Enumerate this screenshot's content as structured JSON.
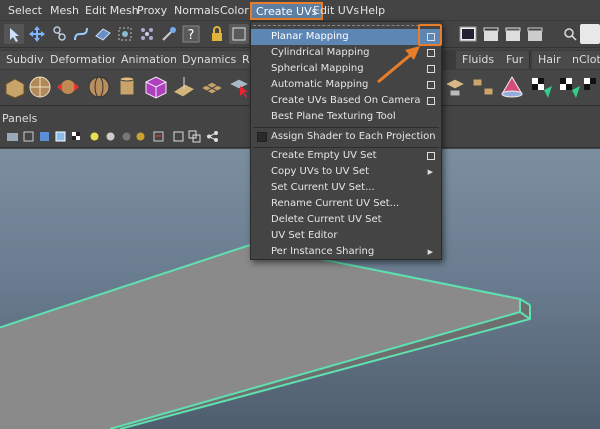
{
  "menubar": {
    "items": [
      "Select",
      "Mesh",
      "Edit Mesh",
      "Proxy",
      "Normals",
      "Color",
      "Create UVs",
      "Edit UVs",
      "Help"
    ]
  },
  "shelf_tabs": [
    "Subdivs",
    "Deformation",
    "Animation",
    "Dynamics",
    "R",
    "Fluids",
    "Fur",
    "Hair",
    "nClot"
  ],
  "panels_label": "Panels",
  "create_uvs_menu": {
    "items": [
      {
        "label": "Planar Mapping",
        "option_box": true,
        "highlight": true
      },
      {
        "label": "Cylindrical Mapping",
        "option_box": true
      },
      {
        "label": "Spherical Mapping",
        "option_box": true
      },
      {
        "label": "Automatic Mapping",
        "option_box": true
      },
      {
        "label": "Create UVs Based On Camera",
        "option_box": true
      },
      {
        "label": "Best Plane Texturing Tool"
      },
      {
        "label": "Assign Shader to Each Projection",
        "checkbox": true
      },
      {
        "label": "Create Empty UV Set",
        "option_box": true
      },
      {
        "label": "Copy UVs to UV Set",
        "submenu": true
      },
      {
        "label": "Set Current UV Set..."
      },
      {
        "label": "Rename Current UV Set..."
      },
      {
        "label": "Delete Current UV Set"
      },
      {
        "label": "UV Set Editor"
      },
      {
        "label": "Per Instance Sharing",
        "submenu": true
      }
    ]
  },
  "colors": {
    "accent": "#e87d2a",
    "highlight": "#5d86b4",
    "wireframe": "#5fe0b0",
    "mesh_top": "#8a8a8a",
    "mesh_side": "#6e6e6e"
  }
}
